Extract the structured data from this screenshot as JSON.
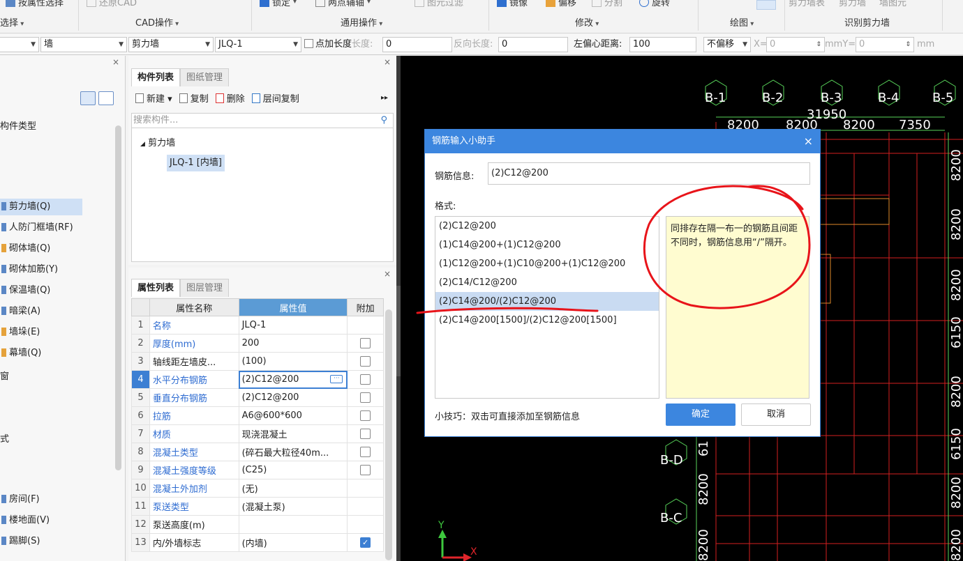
{
  "ribbon": {
    "top_items": [
      {
        "label": "按属性选择",
        "dim": false
      },
      {
        "label": "还原CAD",
        "dim": true
      },
      {
        "label": "锁定",
        "dim": false
      },
      {
        "label": "两点辅轴",
        "dim": false
      },
      {
        "label": "图元过滤",
        "dim": true
      },
      {
        "label": "镜像",
        "dim": false
      },
      {
        "label": "偏移",
        "dim": false
      },
      {
        "label": "分割",
        "dim": true
      },
      {
        "label": "旋转",
        "dim": false
      },
      {
        "label": "剪力墙表",
        "dim": true
      },
      {
        "label": "剪力墙",
        "dim": true
      },
      {
        "label": "墙图元",
        "dim": true
      }
    ],
    "groups": [
      "选择",
      "CAD操作",
      "通用操作",
      "修改",
      "绘图",
      "识别剪力墙"
    ]
  },
  "toolbar": {
    "floor_value": "",
    "type_value": "墙",
    "subtype_value": "剪力墙",
    "component_value": "JLQ-1",
    "point_length_label": "点加长度",
    "length_label": "长度:",
    "length_value": "0",
    "reverse_length_label": "反向长度:",
    "reverse_length_value": "0",
    "left_offset_label": "左偏心距离:",
    "left_offset_value": "100",
    "offset_mode": "不偏移",
    "x_label": "X=",
    "x_value": "0",
    "mm1": "mm",
    "y_label": "mmY=",
    "y_value": "0",
    "mm2": "mm"
  },
  "left_panel": {
    "header": "构件类型",
    "items": [
      {
        "label": "剪力墙(Q)",
        "selected": true,
        "color": "blue"
      },
      {
        "label": "人防门框墙(RF)",
        "selected": false,
        "color": "blue"
      },
      {
        "label": "砌体墙(Q)",
        "selected": false,
        "color": "orange"
      },
      {
        "label": "砌体加筋(Y)",
        "selected": false,
        "color": "blue"
      },
      {
        "label": "保温墙(Q)",
        "selected": false,
        "color": "blue"
      },
      {
        "label": "暗梁(A)",
        "selected": false,
        "color": "blue"
      },
      {
        "label": "墙垛(E)",
        "selected": false,
        "color": "orange"
      },
      {
        "label": "幕墙(Q)",
        "selected": false,
        "color": "orange"
      }
    ],
    "misc1": "窗",
    "misc2": "式",
    "items2": [
      {
        "label": "房间(F)",
        "color": "blue"
      },
      {
        "label": "楼地面(V)",
        "color": "blue"
      },
      {
        "label": "踢脚(S)",
        "color": "blue"
      }
    ]
  },
  "component_list": {
    "tabs": [
      "构件列表",
      "图纸管理"
    ],
    "actions": [
      "新建",
      "复制",
      "删除",
      "层间复制"
    ],
    "search_placeholder": "搜索构件...",
    "tree_root": "剪力墙",
    "tree_leaf": "JLQ-1 [内墙]"
  },
  "property_list": {
    "tabs": [
      "属性列表",
      "图层管理"
    ],
    "headers": [
      "属性名称",
      "属性值",
      "附加"
    ],
    "rows": [
      {
        "n": "1",
        "name": "名称",
        "value": "JLQ-1",
        "blue": true,
        "check": "none"
      },
      {
        "n": "2",
        "name": "厚度(mm)",
        "value": "200",
        "blue": true,
        "check": "off"
      },
      {
        "n": "3",
        "name": "轴线距左墙皮...",
        "value": "(100)",
        "blue": false,
        "check": "off"
      },
      {
        "n": "4",
        "name": "水平分布钢筋",
        "value": "(2)C12@200",
        "blue": true,
        "check": "off",
        "selected": true
      },
      {
        "n": "5",
        "name": "垂直分布钢筋",
        "value": "(2)C12@200",
        "blue": true,
        "check": "off"
      },
      {
        "n": "6",
        "name": "拉筋",
        "value": "A6@600*600",
        "blue": true,
        "check": "off"
      },
      {
        "n": "7",
        "name": "材质",
        "value": "现浇混凝土",
        "blue": true,
        "check": "off"
      },
      {
        "n": "8",
        "name": "混凝土类型",
        "value": "(碎石最大粒径40m...",
        "blue": true,
        "check": "off"
      },
      {
        "n": "9",
        "name": "混凝土强度等级",
        "value": "(C25)",
        "blue": true,
        "check": "off"
      },
      {
        "n": "10",
        "name": "混凝土外加剂",
        "value": "(无)",
        "blue": true,
        "check": "none"
      },
      {
        "n": "11",
        "name": "泵送类型",
        "value": "(混凝土泵)",
        "blue": true,
        "check": "none"
      },
      {
        "n": "12",
        "name": "泵送高度(m)",
        "value": "",
        "blue": false,
        "check": "none"
      },
      {
        "n": "13",
        "name": "内/外墙标志",
        "value": "(内墙)",
        "blue": false,
        "check": "on"
      }
    ]
  },
  "cad": {
    "axis_labels_top": [
      "B-1",
      "B-2",
      "B-3",
      "B-4",
      "B-5"
    ],
    "dims_top": [
      "8200",
      "8200",
      "8200",
      "7350"
    ],
    "dim_total": "31950",
    "axis_labels_left": [
      "B-D",
      "B-C"
    ],
    "dims_left": [
      "61",
      "8200",
      "8200"
    ],
    "dims_right": [
      "8200",
      "8200",
      "8200",
      "6150",
      "8200",
      "6150",
      "8200",
      "8200"
    ],
    "ucs_y": "Y",
    "ucs_x": "X"
  },
  "dialog": {
    "title": "钢筋输入小助手",
    "close": "×",
    "info_label": "钢筋信息:",
    "info_value": "(2)C12@200",
    "format_label": "格式:",
    "options": [
      "(2)C12@200",
      "(1)C14@200+(1)C12@200",
      "(1)C12@200+(1)C10@200+(1)C12@200",
      "(2)C14/C12@200",
      "(2)C14@200/(2)C12@200",
      "(2)C14@200[1500]/(2)C12@200[1500]"
    ],
    "selected_index": 4,
    "hint": "同排存在隔一布一的钢筋且间距不同时，钢筋信息用“/”隔开。",
    "tip": "小技巧：双击可直接添加至钢筋信息",
    "ok": "确定",
    "cancel": "取消"
  },
  "colors": {
    "accent": "#3c86df",
    "annotation": "#e8141a",
    "cad_green": "#58d35a",
    "cad_red": "#d42020",
    "hint_bg": "#fffcd0"
  }
}
